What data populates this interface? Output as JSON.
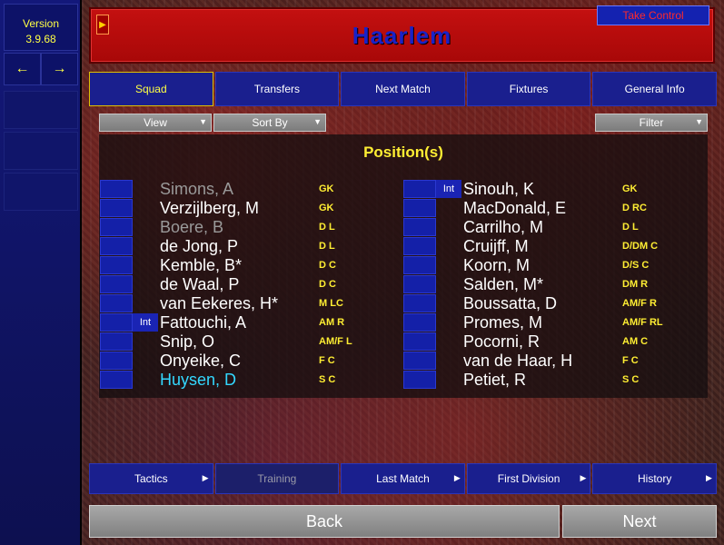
{
  "app": {
    "version_label": "Version",
    "version_number": "3.9.68"
  },
  "team": {
    "name": "Haarlem"
  },
  "header": {
    "take_control": "Take Control"
  },
  "tabs": [
    {
      "label": "Squad",
      "active": true
    },
    {
      "label": "Transfers",
      "active": false
    },
    {
      "label": "Next Match",
      "active": false
    },
    {
      "label": "Fixtures",
      "active": false
    },
    {
      "label": "General Info",
      "active": false
    }
  ],
  "filters": {
    "view": "View",
    "sort_by": "Sort By",
    "filter": "Filter"
  },
  "section": {
    "heading": "Position(s)"
  },
  "players_left": [
    {
      "name": "Simons, A",
      "position": "GK",
      "int": "",
      "style": "dim"
    },
    {
      "name": "Verzijlberg, M",
      "position": "GK",
      "int": "",
      "style": "normal"
    },
    {
      "name": "Boere, B",
      "position": "D L",
      "int": "",
      "style": "dim"
    },
    {
      "name": "de Jong, P",
      "position": "D L",
      "int": "",
      "style": "normal"
    },
    {
      "name": "Kemble, B*",
      "position": "D C",
      "int": "",
      "style": "normal"
    },
    {
      "name": "de Waal, P",
      "position": "D C",
      "int": "",
      "style": "normal"
    },
    {
      "name": "van Eekeres, H*",
      "position": "M LC",
      "int": "",
      "style": "normal"
    },
    {
      "name": "Fattouchi, A",
      "position": "AM R",
      "int": "Int",
      "style": "normal"
    },
    {
      "name": "Snip, O",
      "position": "AM/F L",
      "int": "",
      "style": "normal"
    },
    {
      "name": "Onyeike, C",
      "position": "F C",
      "int": "",
      "style": "normal"
    },
    {
      "name": "Huysen, D",
      "position": "S C",
      "int": "",
      "style": "highlight"
    }
  ],
  "players_right": [
    {
      "name": "Sinouh, K",
      "position": "GK",
      "int": "Int",
      "style": "normal"
    },
    {
      "name": "MacDonald, E",
      "position": "D RC",
      "int": "",
      "style": "normal"
    },
    {
      "name": "Carrilho, M",
      "position": "D L",
      "int": "",
      "style": "normal"
    },
    {
      "name": "Cruijff, M",
      "position": "D/DM C",
      "int": "",
      "style": "normal"
    },
    {
      "name": "Koorn, M",
      "position": "D/S C",
      "int": "",
      "style": "normal"
    },
    {
      "name": "Salden, M*",
      "position": "DM R",
      "int": "",
      "style": "normal"
    },
    {
      "name": "Boussatta, D",
      "position": "AM/F R",
      "int": "",
      "style": "normal"
    },
    {
      "name": "Promes, M",
      "position": "AM/F RL",
      "int": "",
      "style": "normal"
    },
    {
      "name": "Pocorni, R",
      "position": "AM C",
      "int": "",
      "style": "normal"
    },
    {
      "name": "van de Haar, H",
      "position": "F C",
      "int": "",
      "style": "normal"
    },
    {
      "name": "Petiet, R",
      "position": "S C",
      "int": "",
      "style": "normal"
    }
  ],
  "bottom_nav": [
    {
      "label": "Tactics",
      "enabled": true
    },
    {
      "label": "Training",
      "enabled": false
    },
    {
      "label": "Last Match",
      "enabled": true
    },
    {
      "label": "First Division",
      "enabled": true
    },
    {
      "label": "History",
      "enabled": true
    }
  ],
  "buttons": {
    "back": "Back",
    "next": "Next"
  },
  "colors": {
    "title_bar": "#c41010",
    "team_name": "#1a22c8",
    "accent_yellow": "#ffee33",
    "highlight_player": "#33d8ff",
    "tab_background": "#1a1f8e"
  }
}
